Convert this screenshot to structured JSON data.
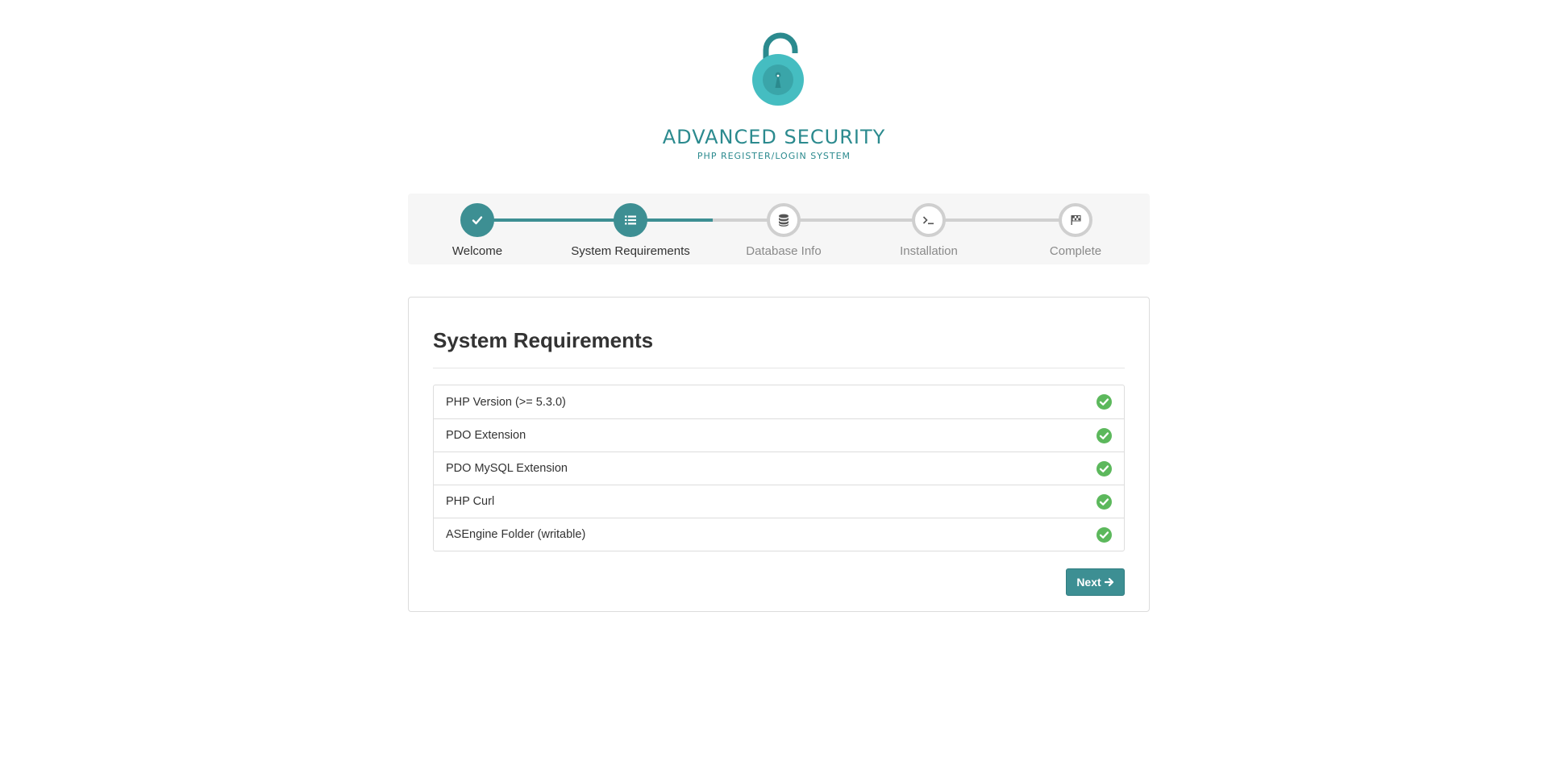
{
  "brand": {
    "title": "ADVANCED SECURITY",
    "subtitle": "PHP REGISTER/LOGIN SYSTEM",
    "logo_icon": "padlock-icon",
    "accent_color": "#3d8f93"
  },
  "wizard": {
    "steps": [
      {
        "label": "Welcome",
        "icon": "check-icon",
        "status": "completed"
      },
      {
        "label": "System Requirements",
        "icon": "list-icon",
        "status": "current"
      },
      {
        "label": "Database Info",
        "icon": "database-icon",
        "status": "pending"
      },
      {
        "label": "Installation",
        "icon": "terminal-icon",
        "status": "pending"
      },
      {
        "label": "Complete",
        "icon": "flag-icon",
        "status": "pending"
      }
    ]
  },
  "panel": {
    "title": "System Requirements",
    "requirements": [
      {
        "label": "PHP Version (>= 5.3.0)",
        "status": "ok"
      },
      {
        "label": "PDO Extension",
        "status": "ok"
      },
      {
        "label": "PDO MySQL Extension",
        "status": "ok"
      },
      {
        "label": "PHP Curl",
        "status": "ok"
      },
      {
        "label": "ASEngine Folder (writable)",
        "status": "ok"
      }
    ],
    "status_color": "#5cb85c",
    "next_label": "Next"
  }
}
